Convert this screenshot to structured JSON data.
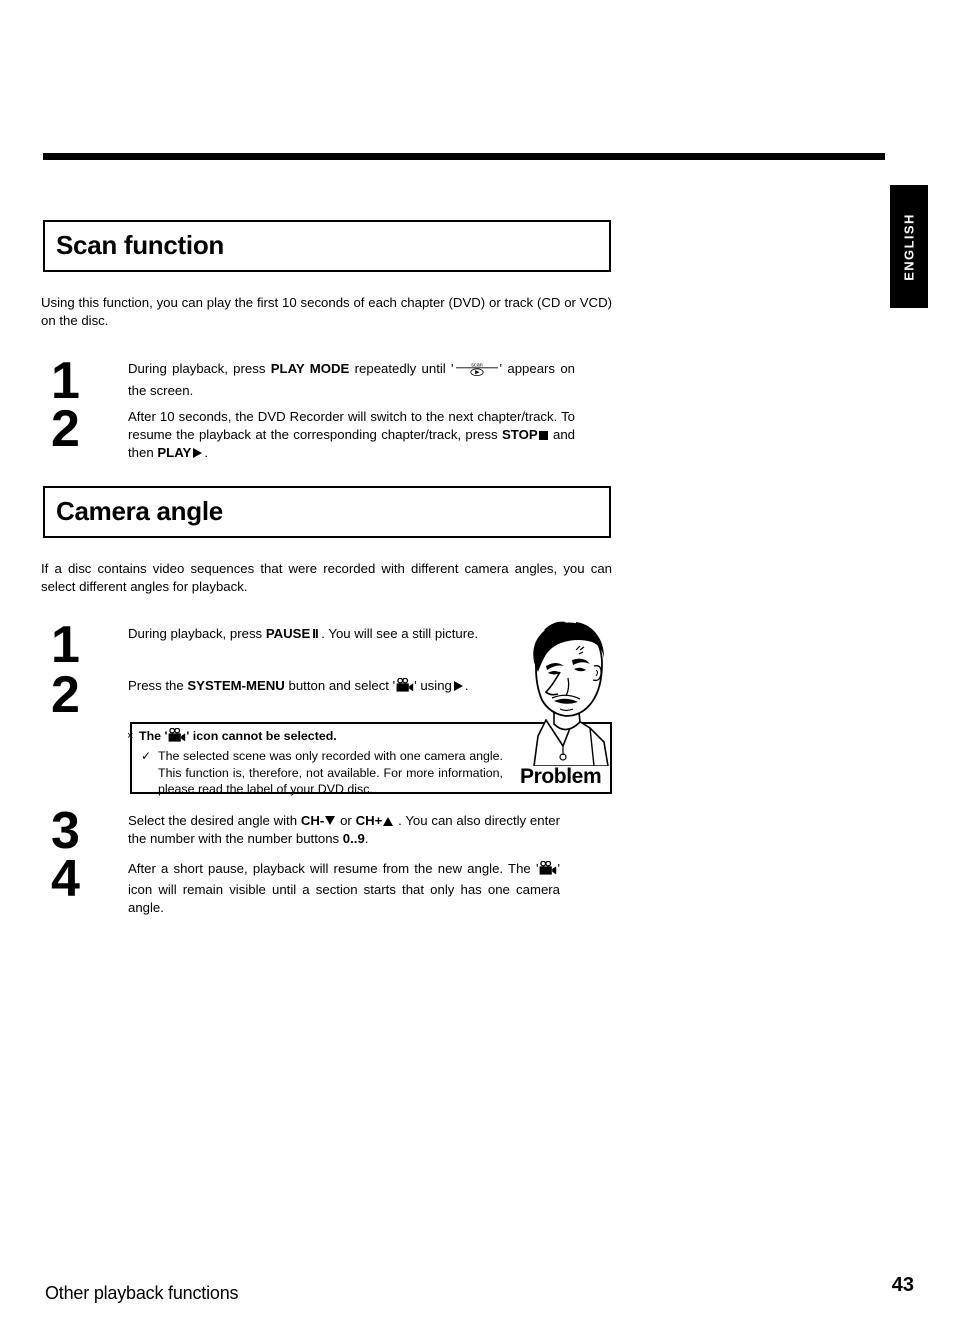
{
  "page": {
    "number": "43",
    "footer_section": "Other playback functions",
    "language_tab": "ENGLISH"
  },
  "sections": [
    {
      "id": "scan",
      "heading": "Scan function",
      "intro": "Using this function, you can play the first 10 seconds of each chapter (DVD) or track (CD or VCD) on the disc.",
      "steps": [
        {
          "number": "1",
          "part1": "During playback, press",
          "bold1": "PLAY MODE",
          "part2": "repeatedly until '",
          "icon": "scan-icon",
          "part3": "' appears on the screen."
        },
        {
          "number": "2",
          "part1": "After 10 seconds, the DVD Recorder will switch to the next chapter/track. To resume the playback at the corresponding chapter/track, press",
          "bold1": "STOP",
          "icon1": "stop-square-icon",
          "part2": "and then",
          "bold2": "PLAY",
          "icon2": "play-triangle-icon",
          "part3": "."
        }
      ]
    },
    {
      "id": "camera",
      "heading": "Camera angle",
      "intro": "If a disc contains video sequences that were recorded with different camera angles, you can select different angles for playback.",
      "steps": [
        {
          "number": "1",
          "part1": "During playback, press",
          "bold1": "PAUSE",
          "bold1_suffix": "II",
          "part2": ". You will see a still picture."
        },
        {
          "number": "2",
          "part1": "Press the",
          "bold1": "SYSTEM-MENU",
          "part2": "button and select '",
          "icon": "movie-camera-icon",
          "part3": "' using",
          "icon2": "play-triangle-icon",
          "part4": "."
        },
        {
          "number": "3",
          "part1": "Select the desired angle with",
          "bold1": "CH-",
          "icon1": "triangle-down-icon",
          "part2": "or",
          "bold2": "CH+",
          "icon2": "triangle-up-icon",
          "part3": ". You can also directly enter the number with the number buttons",
          "bold3": "0..9",
          "part4": "."
        },
        {
          "number": "4",
          "part1": "After a short pause, playback will resume from the new angle. The '",
          "icon": "movie-camera-icon",
          "part2": "' icon will remain visible until a section starts that only has one camera angle."
        }
      ]
    }
  ],
  "problem_box": {
    "label": "Problem",
    "question_prefix": "The '",
    "question_icon": "movie-camera-icon",
    "question_suffix": "' icon cannot be selected.",
    "answer": "The selected scene was only recorded with one camera angle. This function is, therefore, not available. For more information, please read the label of your DVD disc.",
    "x_mark": "×",
    "check_mark": "✓",
    "illustration": "puzzled-man-illustration"
  },
  "scan_icon": {
    "label": "scan"
  },
  "colors": {
    "ink": "#000000",
    "paper": "#ffffff"
  }
}
